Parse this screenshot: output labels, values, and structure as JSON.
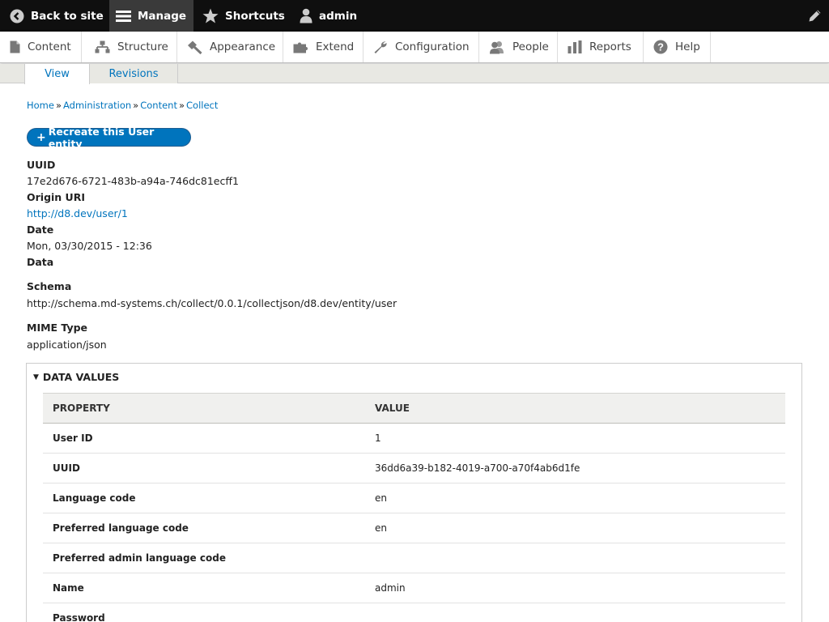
{
  "toolbar": {
    "back_label": "Back to site",
    "manage_label": "Manage",
    "shortcuts_label": "Shortcuts",
    "user_label": "admin"
  },
  "tray": {
    "items": [
      {
        "label": "Content",
        "icon": "page-icon"
      },
      {
        "label": "Structure",
        "icon": "sitemap-icon"
      },
      {
        "label": "Appearance",
        "icon": "paint-icon"
      },
      {
        "label": "Extend",
        "icon": "puzzle-icon"
      },
      {
        "label": "Configuration",
        "icon": "wrench-icon"
      },
      {
        "label": "People",
        "icon": "people-icon"
      },
      {
        "label": "Reports",
        "icon": "bar-chart-icon"
      },
      {
        "label": "Help",
        "icon": "help-icon"
      }
    ]
  },
  "tabs": [
    {
      "label": "View",
      "active": true
    },
    {
      "label": "Revisions",
      "active": false
    }
  ],
  "breadcrumb": [
    "Home",
    "Administration",
    "Content",
    "Collect"
  ],
  "breadcrumb_separator": "»",
  "action": {
    "plus": "+",
    "label": "Recreate this User entity"
  },
  "fields": {
    "uuid_label": "UUID",
    "uuid_value": "17e2d676-6721-483b-a94a-746dc81ecff1",
    "origin_label": "Origin URI",
    "origin_value": "http://d8.dev/user/1",
    "date_label": "Date",
    "date_value": "Mon, 03/30/2015 - 12:36",
    "data_label": "Data",
    "schema_label": "Schema",
    "schema_value": "http://schema.md-systems.ch/collect/0.0.1/collectjson/d8.dev/entity/user",
    "mime_label": "MIME Type",
    "mime_value": "application/json"
  },
  "data_values": {
    "summary": "DATA VALUES",
    "headers": [
      "PROPERTY",
      "VALUE"
    ],
    "rows": [
      [
        "User ID",
        "1"
      ],
      [
        "UUID",
        "36dd6a39-b182-4019-a700-a70f4ab6d1fe"
      ],
      [
        "Language code",
        "en"
      ],
      [
        "Preferred language code",
        "en"
      ],
      [
        "Preferred admin language code",
        ""
      ],
      [
        "Name",
        "admin"
      ],
      [
        "Password",
        ""
      ]
    ]
  },
  "colors": {
    "toolbar_bg": "#0f0f0f",
    "link": "#0074bd",
    "button": "#0074bd"
  }
}
